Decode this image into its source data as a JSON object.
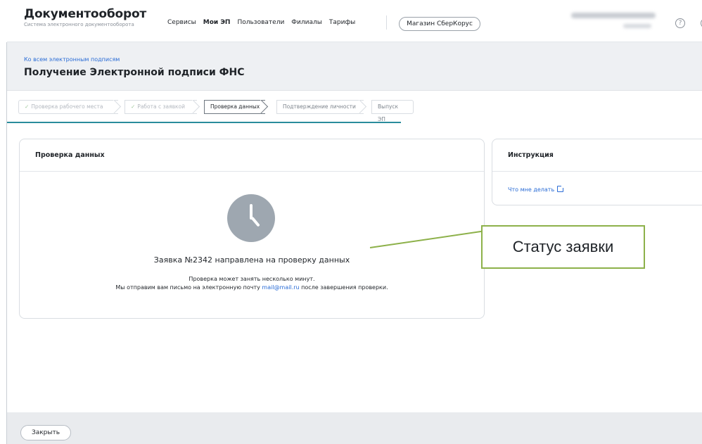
{
  "header": {
    "logo_title": "Документооборот",
    "logo_subtitle": "Система электронного документооборота",
    "nav": [
      "Сервисы",
      "Мои ЭП",
      "Пользователи",
      "Филиалы",
      "Тарифы"
    ],
    "active_nav": "Мои ЭП",
    "store_button": "Магазин СберКорус",
    "help_glyph": "?"
  },
  "title_band": {
    "back_link": "Ко всем электронным подписям",
    "page_title": "Получение Электронной подписи ФНС"
  },
  "stepper": {
    "steps": [
      {
        "label": "Проверка рабочего места",
        "state": "done"
      },
      {
        "label": "Работа с заявкой",
        "state": "done"
      },
      {
        "label": "Проверка данных",
        "state": "current"
      },
      {
        "label": "Подтверждение личности",
        "state": "future"
      },
      {
        "label": "Выпуск ЭП",
        "state": "future"
      }
    ],
    "check_glyph": "✓"
  },
  "status_card": {
    "header": "Проверка данных",
    "icon": "clock-icon",
    "status_title": "Заявка №2342 направлена на проверку данных",
    "line1": "Проверка может занять несколько минут.",
    "line2_before": "Мы отправим вам письмо на электронную почту ",
    "email": "mail@mail.ru",
    "line2_after": " после завершения проверки."
  },
  "instruction_card": {
    "header": "Инструкция",
    "link": "Что мне делать"
  },
  "annotation": {
    "label": "Статус заявки",
    "color": "#8db14a"
  },
  "footer": {
    "close_button": "Закрыть"
  },
  "colors": {
    "link": "#2a6cd6",
    "progress": "#2a8c9c",
    "band_bg": "#eef0f3"
  }
}
